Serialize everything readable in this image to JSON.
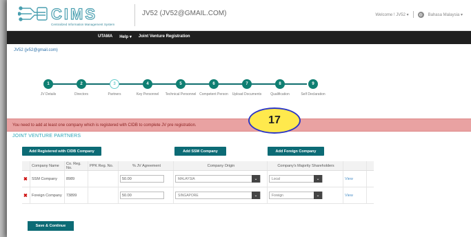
{
  "header": {
    "logo_text": "CIMS",
    "logo_subtitle": "Centralized Information Management System",
    "title": "JV52 (JV52@GMAIL.COM)",
    "welcome": "Welcome ! JV52 ▾",
    "language": "Bahasa Malaysia ▾"
  },
  "nav": {
    "items": [
      "UTAMA",
      "Help ▾",
      "Joint Venture Registration"
    ]
  },
  "user_line": "JV52 (jv52@gmail.com)",
  "steps": [
    {
      "num": "1",
      "label": "JV Details"
    },
    {
      "num": "2",
      "label": "Directors"
    },
    {
      "num": "3",
      "label": "Partners"
    },
    {
      "num": "4",
      "label": "Key Personnel"
    },
    {
      "num": "5",
      "label": "Technical Personnel"
    },
    {
      "num": "6",
      "label": "Competent Person"
    },
    {
      "num": "7",
      "label": "Upload Documents"
    },
    {
      "num": "8",
      "label": "Qualification"
    },
    {
      "num": "9",
      "label": "Self Declaration"
    }
  ],
  "alert": "You need to add at least one company which is registered with CIDB to complete JV pre registration.",
  "callout": "17",
  "section_title": "JOINT VENTURE PARTNERS",
  "buttons": {
    "add_cidb": "Add Registered with CIDB Company",
    "add_ssm": "Add SSM Company",
    "add_foreign": "Add Foreign Company",
    "save": "Save & Continue"
  },
  "table": {
    "headers": [
      "Company Name",
      "Co. Reg. No.",
      "PPK Reg. No.",
      "% JV Agreement",
      "Company Origin",
      "Company's Majority Shareholders"
    ],
    "rows": [
      {
        "name": "SSM Company",
        "co_reg": "8989",
        "ppk": "",
        "pct": "50.00",
        "origin": "MALAYSIA",
        "share": "Local",
        "view": "View"
      },
      {
        "name": "Foreign Company",
        "co_reg": "73899",
        "ppk": "",
        "pct": "50.00",
        "origin": "SINGAPORE",
        "share": "Foreign",
        "view": "View"
      }
    ]
  },
  "colors": {
    "accent": "#0c6b75",
    "alert_bg": "#e9a2a2",
    "nav_bg": "#1f1f1f"
  }
}
